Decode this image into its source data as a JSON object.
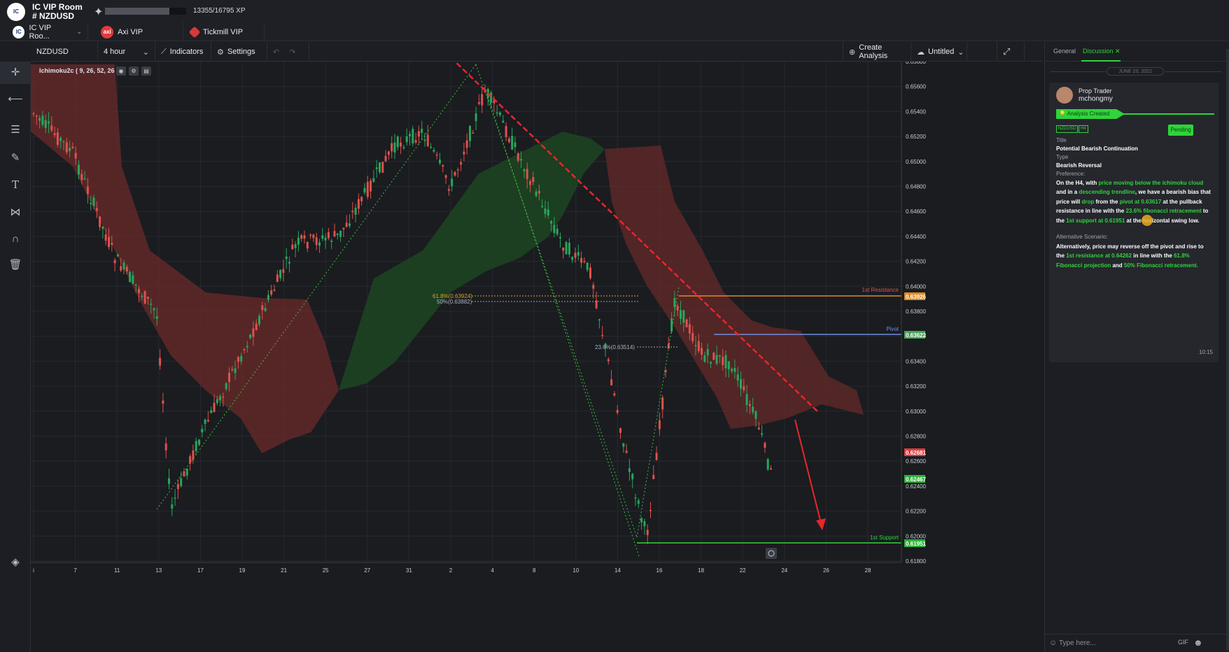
{
  "header": {
    "room_title": "IC VIP Room",
    "room_sub": "# NZDUSD",
    "logo_text": "IC",
    "xp": "13355/16795 XP",
    "xp_fraction": 0.795
  },
  "rooms": [
    {
      "label": "IC VIP Roo...",
      "badge": "IC",
      "color": "#ffffff",
      "badge_color": "#1b3a7a"
    },
    {
      "label": "Axi VIP",
      "badge": "axi",
      "color": "#e23b3b",
      "badge_color": "#ffffff"
    },
    {
      "label": "Tickmill VIP",
      "badge": "",
      "color": "#d63a3a",
      "badge_color": "#ffffff"
    }
  ],
  "toolbar": {
    "symbol": "NZDUSD",
    "timeframe": "4 hour",
    "indicators": "Indicators",
    "settings": "Settings",
    "create_analysis": "Create Analysis",
    "untitled": "Untitled"
  },
  "chart": {
    "indicator_label": "Ichimoku2c ( 9, 26, 52, 26 )",
    "price_ticks": [
      "0.65800",
      "0.65600",
      "0.65400",
      "0.65200",
      "0.65000",
      "0.64800",
      "0.64600",
      "0.64400",
      "0.64200",
      "0.64000",
      "0.63800",
      "0.63600",
      "0.63400",
      "0.63200",
      "0.63000",
      "0.62800",
      "0.62600",
      "0.62400",
      "0.62200",
      "0.62000",
      "0.61800"
    ],
    "date_ticks": [
      "i",
      "7",
      "11",
      "13",
      "17",
      "19",
      "21",
      "25",
      "27",
      "31",
      "2",
      "4",
      "8",
      "10",
      "14",
      "16",
      "18",
      "22",
      "24",
      "26",
      "28"
    ],
    "price_badges": [
      {
        "value": "0.63926",
        "color": "#e08a1e"
      },
      {
        "value": "0.63622",
        "color": "#4aa35a"
      },
      {
        "value": "0.62681",
        "color": "#e23b3b"
      },
      {
        "value": "0.62467",
        "color": "#2fb33a"
      },
      {
        "value": "0.61951",
        "color": "#2fb33a"
      }
    ],
    "levels": {
      "resistance": "1st Resistance",
      "pivot": "Pivot",
      "support": "1st Support",
      "fib_618": "61.8%(0.63924)",
      "fib_50": "50%(0.63882)",
      "fib_236": "23.6%(0.63514)"
    },
    "colors": {
      "bull": "#26a65b",
      "bear": "#e0504c",
      "cloud_bear": "#6b2a2a",
      "cloud_bull": "#1d4a22",
      "trendline": "#e8262b"
    }
  },
  "panel": {
    "tab_general": "General",
    "tab_discussion": "Discussion",
    "date": "JUNE 23, 2022",
    "author_role": "Prop Trader",
    "author_name": "mchongmy",
    "status": "Analysis Created",
    "tags": [
      "NZDUSD",
      "H4"
    ],
    "state": "Pending",
    "title_label": "Title",
    "title_value": "Potential Bearish Continuation",
    "type_label": "Type",
    "type_value": "Bearish Reversal",
    "preference_label": "Preference:",
    "preference_parts": [
      {
        "t": "On the H4, with ",
        "g": false
      },
      {
        "t": "price moving below the ichimoku cloud",
        "g": true
      },
      {
        "t": " and in a ",
        "g": false
      },
      {
        "t": "descending trendline",
        "g": true
      },
      {
        "t": ", we have a bearish bias that price will ",
        "g": false
      },
      {
        "t": "drop",
        "g": true
      },
      {
        "t": " from the ",
        "g": false
      },
      {
        "t": "pivot at 0.63617",
        "g": true
      },
      {
        "t": " at the pullback resistance in line with the ",
        "g": false
      },
      {
        "t": "23.6% fibonacci retracement",
        "g": true
      },
      {
        "t": " to the ",
        "g": false
      },
      {
        "t": "1st support at 0.61951",
        "g": true
      },
      {
        "t": " at the horizontal swing low.",
        "g": false
      }
    ],
    "alt_label": "Alternative Scenario:",
    "alt_parts": [
      {
        "t": "Alternatively, price may reverse off the pivot and rise to the ",
        "g": false
      },
      {
        "t": "1st resistance at 0.64262",
        "g": true
      },
      {
        "t": " in line with the ",
        "g": false
      },
      {
        "t": "61.8% Fibonacci projection",
        "g": true
      },
      {
        "t": " and ",
        "g": false
      },
      {
        "t": "50% Fibonacci retracement.",
        "g": true
      }
    ],
    "time": "10:15",
    "input_placeholder": "Type here...",
    "gif": "GIF"
  },
  "icons": {
    "crosshair": "crosshair-icon",
    "line": "line-icon",
    "fib": "fibonacci-icon",
    "brush": "brush-icon",
    "text": "text-icon",
    "pattern": "pattern-icon",
    "magnet": "magnet-icon",
    "trash": "trash-icon",
    "layers": "layers-icon"
  }
}
